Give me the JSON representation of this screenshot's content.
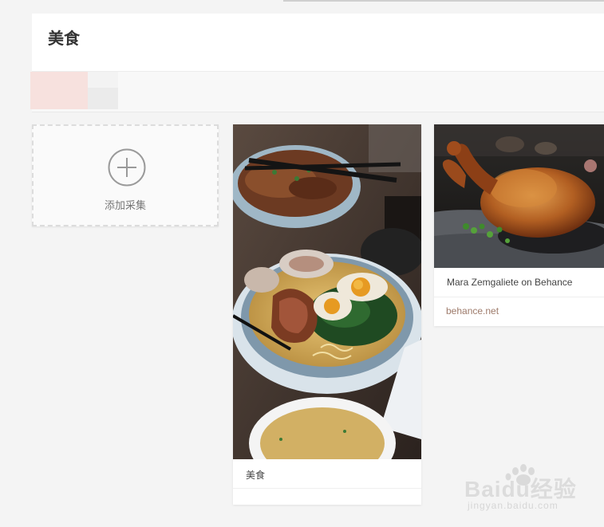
{
  "board": {
    "title": "美食"
  },
  "add_card": {
    "label": "添加采集"
  },
  "pins": [
    {
      "caption": "美食",
      "source": ""
    },
    {
      "caption": "Mara Zemgaliete on Behance",
      "source": "behance.net"
    }
  ],
  "watermark": {
    "brand": "Baidu经验",
    "url": "jingyan.baidu.com"
  },
  "colors": {
    "background": "#f4f4f4",
    "source_link": "#9e7b6b",
    "accent_blur": "#f7e1de"
  },
  "icons": [
    "plus-circle-icon",
    "baidu-paw-icon"
  ]
}
